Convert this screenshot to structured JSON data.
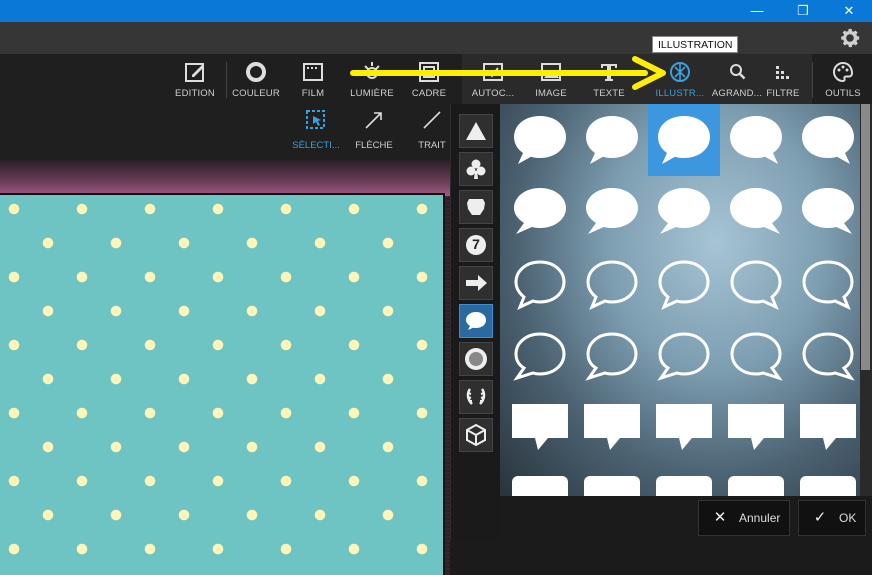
{
  "window": {
    "controls": [
      "—",
      "❐",
      "✕"
    ]
  },
  "toolbar": {
    "items": [
      {
        "label": "EDITION",
        "icon": "edit-icon"
      },
      {
        "label": "COULEUR",
        "icon": "circle-icon"
      },
      {
        "label": "FILM",
        "icon": "film-icon"
      },
      {
        "label": "LUMIÈRE",
        "icon": "sun-icon"
      },
      {
        "label": "CADRE",
        "icon": "frame-icon"
      },
      {
        "label": "AUTOC...",
        "icon": "sticker-icon"
      },
      {
        "label": "IMAGE",
        "icon": "image-icon"
      },
      {
        "label": "TEXTE",
        "icon": "text-icon"
      },
      {
        "label": "ILLUSTR...",
        "icon": "illustration-icon"
      },
      {
        "label": "AGRAND...",
        "icon": "zoom-icon"
      },
      {
        "label": "FILTRE",
        "icon": "filter-icon"
      },
      {
        "label": "OUTILS",
        "icon": "palette-icon"
      }
    ],
    "active": "ILLUSTR..."
  },
  "tooltip": {
    "text": "ILLUSTRATION"
  },
  "subtools": {
    "items": [
      {
        "label": "SÉLECTI...",
        "icon": "select-icon"
      },
      {
        "label": "FLÈCHE",
        "icon": "arrow-icon"
      },
      {
        "label": "TRAIT",
        "icon": "line-icon"
      }
    ]
  },
  "categories": [
    "triangle-icon",
    "club-icon",
    "shield-icon",
    "number-badge-icon",
    "arrow-right-icon",
    "speech-bubble-icon",
    "seal-icon",
    "laurel-icon",
    "cube-icon"
  ],
  "category_badge_text": "7",
  "gallery": {
    "rows": [
      "bubble-filled-round",
      "bubble-filled-round-alt",
      "bubble-outline-round",
      "bubble-outline-round-alt",
      "bubble-filled-rect",
      "bubble-filled-rect-partial"
    ],
    "selected_row": 0,
    "selected_col": 2
  },
  "accent": "#3d97df",
  "actions": {
    "cancel_label": "Annuler",
    "ok_label": "OK"
  }
}
